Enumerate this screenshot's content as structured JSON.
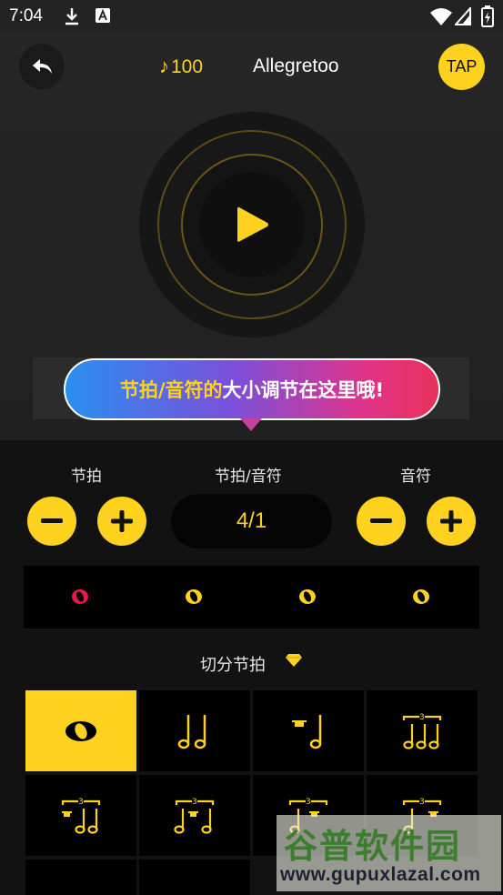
{
  "status_bar": {
    "time": "7:04"
  },
  "header": {
    "tempo_note_glyph": "♪",
    "tempo_value": "100",
    "tempo_name": "Allegretoo",
    "tap_label": "TAP"
  },
  "tooltip": {
    "highlight_text": "节拍/音符的",
    "rest_text": "大小调节在这里哦!"
  },
  "controls": {
    "beat_label": "节拍",
    "ratio_label": "节拍/音符",
    "note_label": "音符",
    "ratio_value": "4/1"
  },
  "beats": {
    "count": 4,
    "active_index": 0,
    "active_color": "#e8194a",
    "inactive_color": "#ffd21f"
  },
  "syncopation": {
    "label": "切分节拍",
    "badge_icon": "diamond-icon",
    "patterns": [
      "whole-note",
      "two-half-notes",
      "rest-half-note",
      "half-note-triplet",
      "rest-triplet",
      "triplet-rest-mid",
      "rest-triplet-alt",
      "rest-triplet-end"
    ],
    "selected_index": 0
  },
  "watermark": {
    "title": "谷普软件园",
    "url": "www.gupuxlazal.com"
  },
  "colors": {
    "accent": "#ffd21f",
    "background": "#121212"
  }
}
